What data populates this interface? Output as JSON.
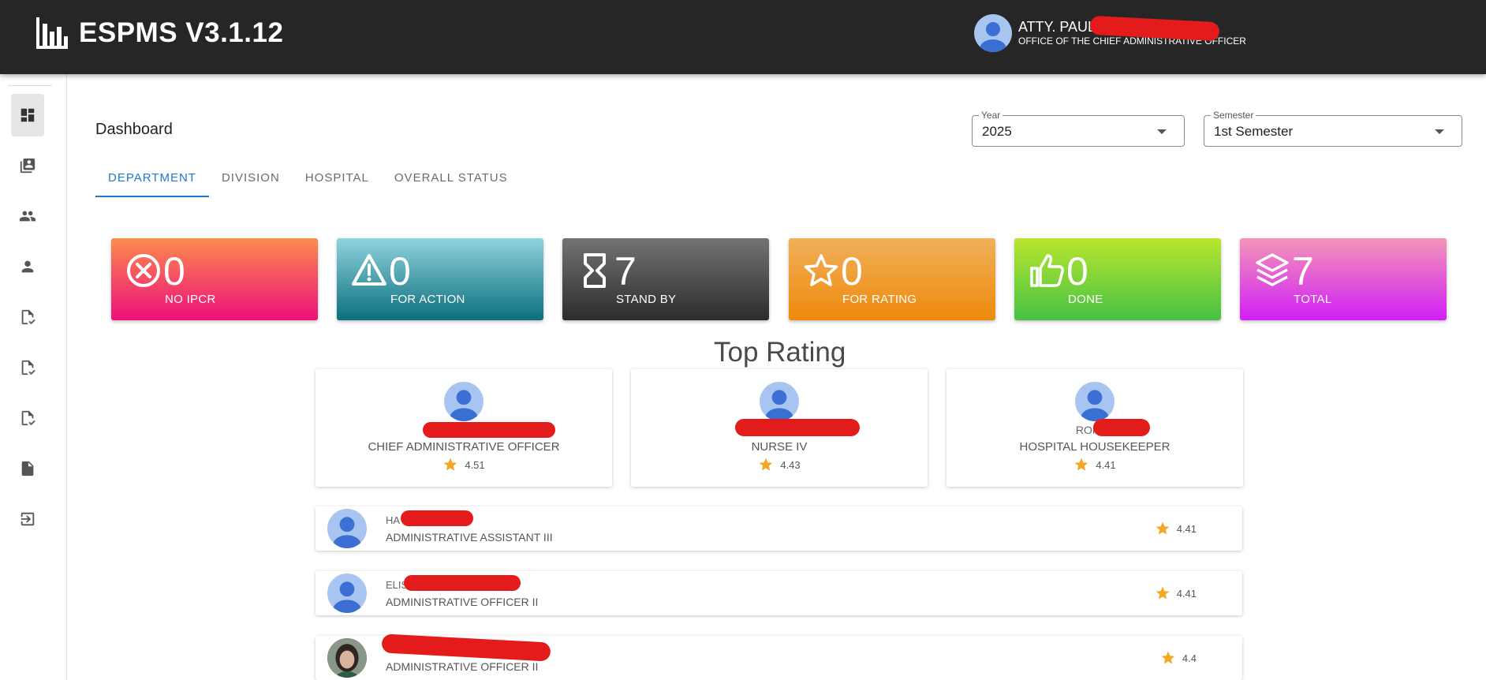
{
  "app": {
    "title": "ESPMS V3.1.12"
  },
  "user": {
    "name": "ATTY. PAUL",
    "office": "OFFICE OF THE CHIEF ADMINISTRATIVE OFFICER"
  },
  "sidebar": {
    "items": [
      {
        "icon": "dashboard-icon",
        "active": true
      },
      {
        "icon": "contacts-book-icon"
      },
      {
        "icon": "people-icon"
      },
      {
        "icon": "person-icon"
      },
      {
        "icon": "document-check-icon"
      },
      {
        "icon": "document-check-icon"
      },
      {
        "icon": "document-check-icon"
      },
      {
        "icon": "document-icon"
      },
      {
        "icon": "logout-icon"
      }
    ]
  },
  "page": {
    "title": "Dashboard"
  },
  "filters": {
    "year": {
      "label": "Year",
      "value": "2025"
    },
    "semester": {
      "label": "Semester",
      "value": "1st Semester"
    }
  },
  "tabs": [
    {
      "label": "DEPARTMENT",
      "active": true
    },
    {
      "label": "DIVISION"
    },
    {
      "label": "HOSPITAL"
    },
    {
      "label": "OVERALL STATUS"
    }
  ],
  "stats": [
    {
      "value": "0",
      "label": "NO IPCR",
      "icon": "x-circle-icon",
      "colors": [
        "#fb8c4d",
        "#ee0f7b"
      ]
    },
    {
      "value": "0",
      "label": "FOR ACTION",
      "icon": "warning-icon",
      "colors": [
        "#8fd3de",
        "#0b6f7d"
      ]
    },
    {
      "value": "7",
      "label": "STAND BY",
      "icon": "hourglass-icon",
      "colors": [
        "#737373",
        "#2c2c2c"
      ]
    },
    {
      "value": "0",
      "label": "FOR RATING",
      "icon": "star-outline-icon",
      "colors": [
        "#f0b05a",
        "#ee8a0b"
      ]
    },
    {
      "value": "0",
      "label": "DONE",
      "icon": "thumbs-up-icon",
      "colors": [
        "#b9e62f",
        "#46c144"
      ]
    },
    {
      "value": "7",
      "label": "TOTAL",
      "icon": "layers-icon",
      "colors": [
        "#f495b8",
        "#d01ff5"
      ]
    }
  ],
  "top_rating": {
    "title": "Top Rating",
    "cards": [
      {
        "name": "ATTY",
        "position": "CHIEF ADMINISTRATIVE OFFICER",
        "rating": "4.51"
      },
      {
        "name": "RHEA",
        "position": "NURSE IV",
        "rating": "4.43"
      },
      {
        "name": "RONAL",
        "position": "HOSPITAL HOUSEKEEPER",
        "rating": "4.41"
      }
    ],
    "list": [
      {
        "name": "HA",
        "position": "ADMINISTRATIVE ASSISTANT III",
        "rating": "4.41",
        "photo": false
      },
      {
        "name": "ELIS",
        "position": "ADMINISTRATIVE OFFICER II",
        "rating": "4.41",
        "photo": false
      },
      {
        "name": "",
        "position": "ADMINISTRATIVE OFFICER II",
        "rating": "4.4",
        "photo": true
      }
    ]
  }
}
